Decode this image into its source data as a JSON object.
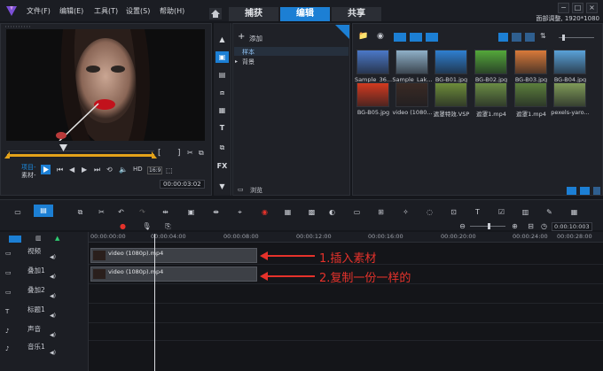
{
  "menu": [
    "文件(F)",
    "编辑(E)",
    "工具(T)",
    "设置(S)",
    "帮助(H)"
  ],
  "tabs": [
    {
      "label": "捕获",
      "active": false
    },
    {
      "label": "编辑",
      "active": true
    },
    {
      "label": "共享",
      "active": false
    }
  ],
  "resolution_text": "面部调整, 1920*1080",
  "player": {
    "mode_project": "项目-",
    "mode_clip": "素材-",
    "hd_label": "HD",
    "ratio_label": "16:9",
    "timecode": "00:00:03:02"
  },
  "library": {
    "add_label": "添加",
    "folders": [
      "样本",
      "背景"
    ],
    "browse_label": "浏览",
    "items": [
      {
        "caption": "Sample_36...",
        "color": "#4b78c8"
      },
      {
        "caption": "Sample_Lak...",
        "color": "#8fb0c8"
      },
      {
        "caption": "BG-B01.jpg",
        "color": "#2f7fd0"
      },
      {
        "caption": "BG-B02.jpg",
        "color": "#54a83a"
      },
      {
        "caption": "BG-B03.jpg",
        "color": "#d97a3a"
      },
      {
        "caption": "BG-B04.jpg",
        "color": "#5aa2d9"
      },
      {
        "caption": "BG-B05.jpg",
        "color": "#d33a1f"
      },
      {
        "caption": "video (1080...",
        "color": "#3a2a24"
      },
      {
        "caption": "遮罩特效.VSP",
        "color": "#6d8c3a"
      },
      {
        "caption": "遮罩1.mp4",
        "color": "#6a8c44"
      },
      {
        "caption": "遮罩1.mp4",
        "color": "#5c7f3c"
      },
      {
        "caption": "pexels-yaro...",
        "color": "#7f9a58"
      }
    ]
  },
  "timeline": {
    "zoom_timecode": "0:00:10:003",
    "ruler": [
      "00:00:00:00",
      "00:00:04:00",
      "00:00:08:00",
      "00:00:12:00",
      "00:00:16:00",
      "00:00:20:00",
      "00:00:24:00",
      "00:00:28:00"
    ],
    "tracks": [
      "视频",
      "叠加1",
      "叠加2",
      "标题1",
      "声音",
      "音乐1"
    ],
    "clips": [
      {
        "label": "video (1080p).mp4",
        "track": "视频"
      },
      {
        "label": "video (1080p).mp4",
        "track": "叠加1"
      }
    ]
  },
  "annotations": [
    "1.插入素材",
    "2.复制一份一样的"
  ],
  "colors": {
    "accent": "#1c7fd4",
    "annotation": "#e5322b",
    "scrub": "#e3a21a"
  }
}
